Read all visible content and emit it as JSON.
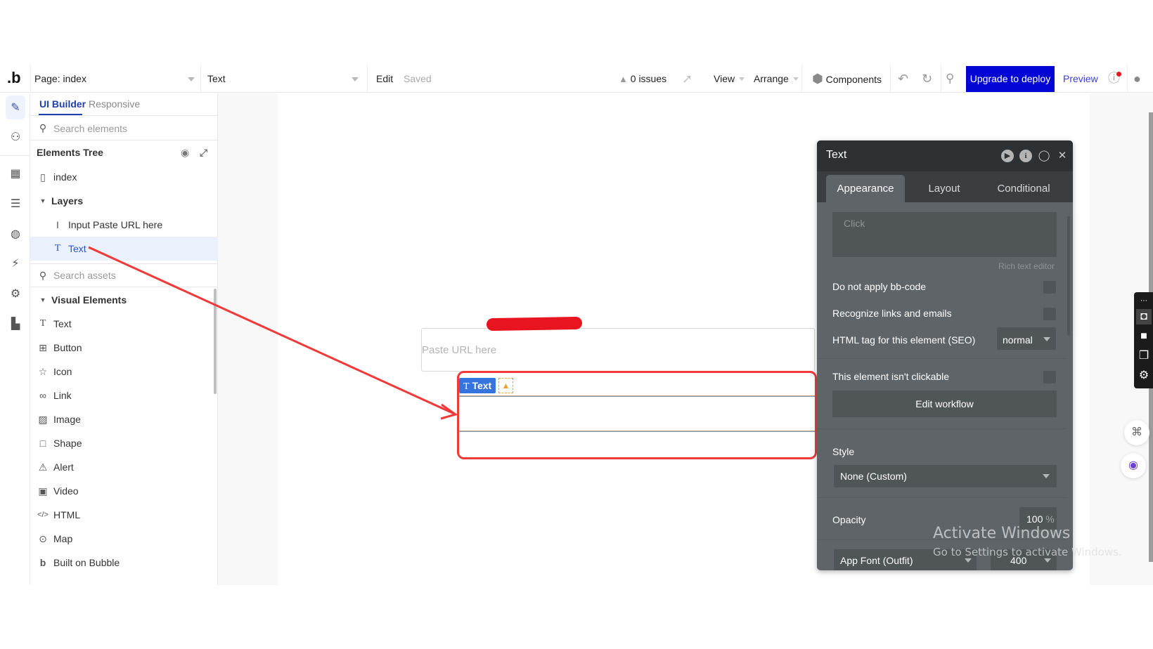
{
  "topbar": {
    "logo": ".b",
    "page_select": "Page: index",
    "element_select": "Text",
    "edit": "Edit",
    "saved": "Saved",
    "issues": "0 issues",
    "view": "View",
    "arrange": "Arrange",
    "components": "Components",
    "upgrade": "Upgrade to deploy",
    "preview": "Preview"
  },
  "left_panel": {
    "tabs": [
      "UI Builder",
      "Responsive"
    ],
    "search_elements_placeholder": "Search elements",
    "tree_title": "Elements Tree",
    "tree": {
      "page": "index",
      "layers": "Layers",
      "items": [
        "Input Paste URL here",
        "Text"
      ]
    },
    "search_assets_placeholder": "Search assets",
    "visual_elements_title": "Visual Elements",
    "visual_elements": [
      "Text",
      "Button",
      "Icon",
      "Link",
      "Image",
      "Shape",
      "Alert",
      "Video",
      "HTML",
      "Map",
      "Built on Bubble"
    ]
  },
  "canvas": {
    "input_placeholder": "Paste URL here",
    "selected_badge": "Text"
  },
  "editor": {
    "title": "Text",
    "tabs": [
      "Appearance",
      "Layout",
      "Conditional"
    ],
    "content_placeholder": "Click",
    "rich_text_label": "Rich text editor",
    "checks": [
      "Do not apply bb-code",
      "Recognize links and emails"
    ],
    "html_tag_label": "HTML tag for this element (SEO)",
    "html_tag_value": "normal",
    "not_clickable_label": "This element isn't clickable",
    "edit_workflow": "Edit workflow",
    "style_label": "Style",
    "style_value": "None (Custom)",
    "opacity_label": "Opacity",
    "opacity_value": "100",
    "opacity_unit": "%",
    "font_value": "App Font (Outfit)",
    "weight_value": "400"
  },
  "overlay": {
    "watermark_title": "Activate Windows",
    "watermark_sub": "Go to Settings to activate Windows."
  },
  "colors": {
    "accent": "#0205d3",
    "annotation": "#f03a3a",
    "selected_badge": "#3574df"
  }
}
